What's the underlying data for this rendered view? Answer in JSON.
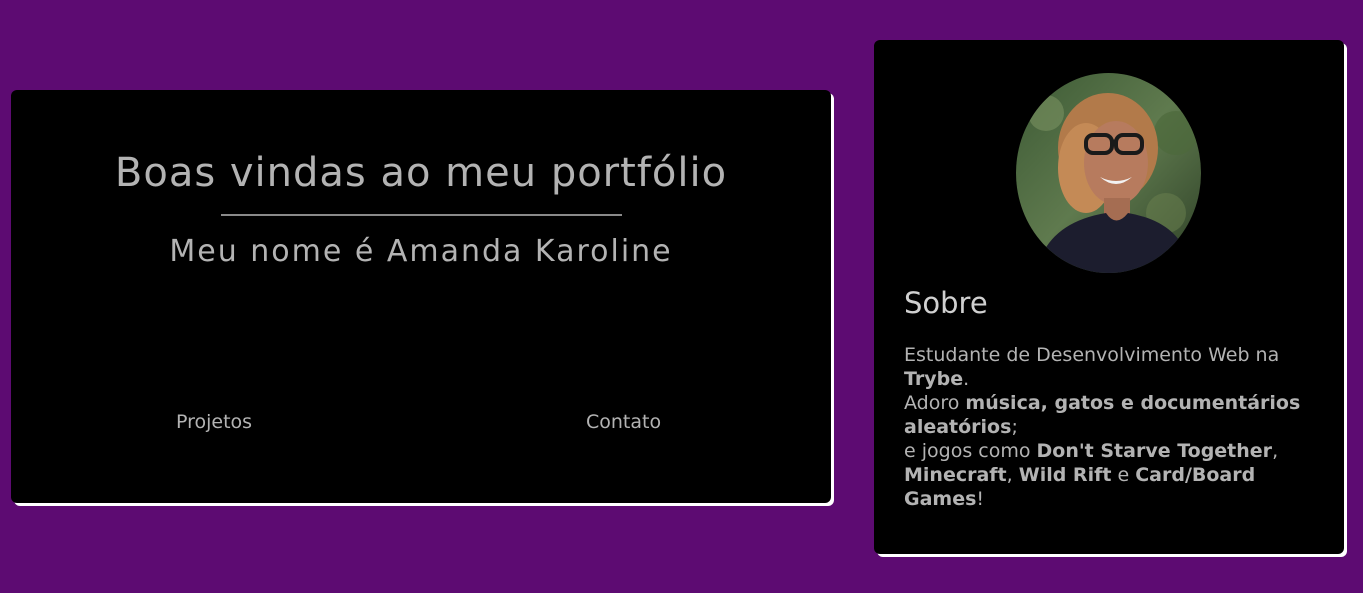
{
  "welcome": {
    "title": "Boas vindas ao meu portfólio",
    "subtitle": "Meu nome é Amanda Karoline"
  },
  "nav": {
    "projetos": "Projetos",
    "contato": "Contato"
  },
  "about": {
    "heading": "Sobre",
    "line1_prefix": "Estudante de Desenvolvimento Web na ",
    "line1_bold": "Trybe",
    "line1_suffix": ".",
    "line2_prefix": "Adoro ",
    "line2_bold": "música, gatos e documentários aleatórios",
    "line2_suffix": ";",
    "line3_prefix": "e jogos como ",
    "game1": "Don't Starve Together",
    "sep1": ", ",
    "game2": "Minecraft",
    "sep2": ", ",
    "game3": "Wild Rift",
    "sep3": " e ",
    "game4": "Card/Board Games",
    "end": "!"
  },
  "colors": {
    "background": "#5d0b72",
    "card": "#000000",
    "text": "#b3b3b3"
  }
}
